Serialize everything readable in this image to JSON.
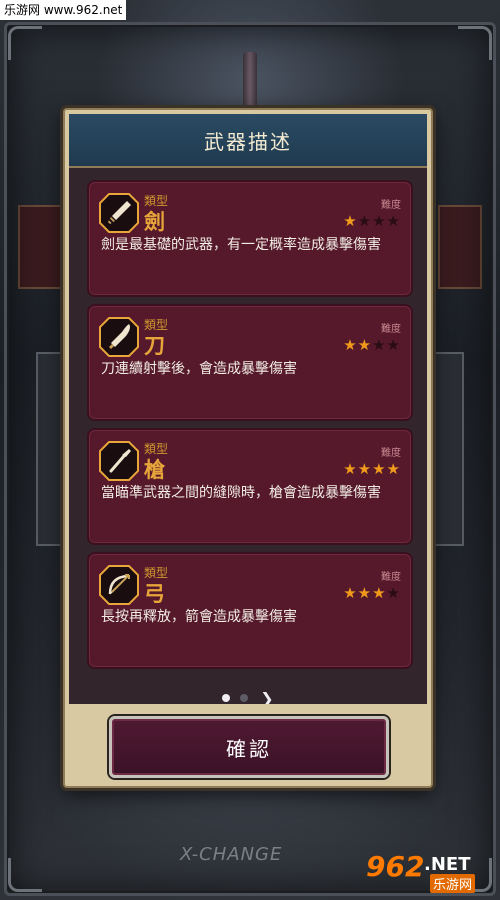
{
  "watermark_top": "乐游网 www.962.net",
  "dialog": {
    "title": "武器描述",
    "difficulty_label": "難度",
    "type_label": "類型",
    "cards": [
      {
        "icon": "sword-icon",
        "name": "劍",
        "stars": 1,
        "max_stars": 4,
        "desc": "劍是最基礎的武器，有一定概率造成暴擊傷害"
      },
      {
        "icon": "blade-icon",
        "name": "刀",
        "stars": 2,
        "max_stars": 4,
        "desc": "刀連續射擊後，會造成暴擊傷害"
      },
      {
        "icon": "spear-icon",
        "name": "槍",
        "stars": 4,
        "max_stars": 4,
        "desc": "當瞄準武器之間的縫隙時，槍會造成暴擊傷害"
      },
      {
        "icon": "bow-icon",
        "name": "弓",
        "stars": 3,
        "max_stars": 4,
        "desc": "長按再釋放，箭會造成暴擊傷害"
      }
    ],
    "pager": {
      "current_page": 1,
      "total_pages": 2,
      "next_symbol": "❯"
    },
    "confirm_label": "確認"
  },
  "watermark_bottom": {
    "xchange": "X-CHANGE",
    "logo_number": "962",
    "logo_domain": ".NET",
    "logo_cn": "乐游网"
  },
  "colors": {
    "header": "#1f3a4f",
    "card": "#55192b",
    "star_on": "#f09a1c",
    "accent": "#e8a53a"
  }
}
